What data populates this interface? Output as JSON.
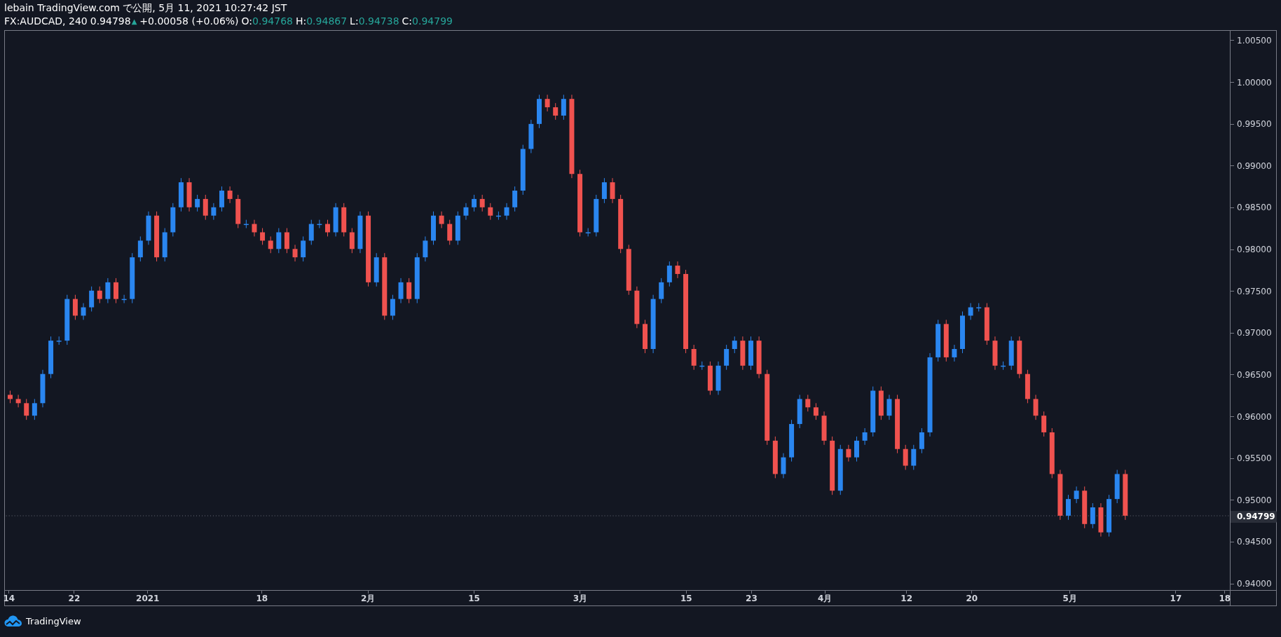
{
  "header": {
    "title": "lebain TradingView.com で公開, 5月 11, 2021 10:27:42 JST"
  },
  "legend": {
    "symbol": "FX:AUDCAD, 240",
    "last": "0.94798",
    "change_mark": "▲",
    "change": "+0.00058 (+0.06%)",
    "ohlc": [
      {
        "label": "O:",
        "value": "0.94768"
      },
      {
        "label": "H:",
        "value": "0.94867"
      },
      {
        "label": "L:",
        "value": "0.94738"
      },
      {
        "label": "C:",
        "value": "0.94799"
      }
    ]
  },
  "chart": {
    "chart_data": {
      "type": "candlestick",
      "ylim": [
        0.93908,
        1.00617
      ],
      "yticks": [
        {
          "value": 1.005,
          "label": "1.00500"
        },
        {
          "value": 1.0,
          "label": "1.00000"
        },
        {
          "value": 0.995,
          "label": "0.99500"
        },
        {
          "value": 0.99,
          "label": "0.99000"
        },
        {
          "value": 0.985,
          "label": "0.98500"
        },
        {
          "value": 0.98,
          "label": "0.98000"
        },
        {
          "value": 0.975,
          "label": "0.97500"
        },
        {
          "value": 0.97,
          "label": "0.97000"
        },
        {
          "value": 0.965,
          "label": "0.96500"
        },
        {
          "value": 0.96,
          "label": "0.96000"
        },
        {
          "value": 0.955,
          "label": "0.95500"
        },
        {
          "value": 0.95,
          "label": "0.95000"
        },
        {
          "value": 0.945,
          "label": "0.94500"
        },
        {
          "value": 0.94,
          "label": "0.94000"
        }
      ],
      "categories": [
        "14",
        null,
        null,
        null,
        null,
        null,
        null,
        null,
        "22",
        null,
        null,
        null,
        null,
        null,
        null,
        null,
        null,
        "2021",
        null,
        null,
        null,
        null,
        null,
        null,
        null,
        null,
        null,
        null,
        null,
        null,
        null,
        "18",
        null,
        null,
        null,
        null,
        null,
        null,
        null,
        null,
        null,
        null,
        null,
        null,
        "2月",
        null,
        null,
        null,
        null,
        null,
        null,
        null,
        null,
        null,
        null,
        null,
        null,
        "15",
        null,
        null,
        null,
        null,
        null,
        null,
        null,
        null,
        null,
        null,
        null,
        null,
        "3月",
        null,
        null,
        null,
        null,
        null,
        null,
        null,
        null,
        null,
        null,
        null,
        null,
        "15",
        null,
        null,
        null,
        null,
        null,
        null,
        null,
        "23",
        null,
        null,
        null,
        null,
        null,
        null,
        null,
        null,
        "4月",
        null,
        null,
        null,
        null,
        null,
        null,
        null,
        null,
        null,
        "12",
        null,
        null,
        null,
        null,
        null,
        null,
        null,
        "20",
        null,
        null,
        null,
        null,
        null,
        null,
        null,
        null,
        null,
        null,
        null,
        "5月",
        null,
        null,
        null,
        null,
        null,
        null,
        null,
        null,
        null,
        null,
        null,
        null,
        "17",
        null,
        null,
        null,
        null,
        null,
        "18"
      ],
      "ohlc": [
        [
          0.9625,
          0.963,
          0.9615,
          0.962
        ],
        [
          0.962,
          0.9625,
          0.961,
          0.9615
        ],
        [
          0.9615,
          0.962,
          0.9595,
          0.96
        ],
        [
          0.96,
          0.962,
          0.9595,
          0.9615
        ],
        [
          0.9615,
          0.9655,
          0.961,
          0.965
        ],
        [
          0.965,
          0.9695,
          0.9645,
          0.969
        ],
        [
          0.969,
          0.9695,
          0.9685,
          0.969
        ],
        [
          0.969,
          0.9745,
          0.9685,
          0.974
        ],
        [
          0.974,
          0.9745,
          0.9715,
          0.972
        ],
        [
          0.972,
          0.9735,
          0.9715,
          0.973
        ],
        [
          0.973,
          0.9755,
          0.9725,
          0.975
        ],
        [
          0.975,
          0.9755,
          0.9735,
          0.974
        ],
        [
          0.974,
          0.9765,
          0.9735,
          0.976
        ],
        [
          0.976,
          0.9765,
          0.9735,
          0.974
        ],
        [
          0.974,
          0.9745,
          0.9735,
          0.974
        ],
        [
          0.974,
          0.9795,
          0.9735,
          0.979
        ],
        [
          0.979,
          0.9815,
          0.9785,
          0.981
        ],
        [
          0.981,
          0.9845,
          0.9805,
          0.984
        ],
        [
          0.984,
          0.9845,
          0.9785,
          0.979
        ],
        [
          0.979,
          0.9825,
          0.9785,
          0.982
        ],
        [
          0.982,
          0.9855,
          0.9815,
          0.985
        ],
        [
          0.985,
          0.9885,
          0.9845,
          0.988
        ],
        [
          0.988,
          0.9885,
          0.9845,
          0.985
        ],
        [
          0.985,
          0.9865,
          0.9845,
          0.986
        ],
        [
          0.986,
          0.9865,
          0.9835,
          0.984
        ],
        [
          0.984,
          0.9855,
          0.9835,
          0.985
        ],
        [
          0.985,
          0.9875,
          0.9845,
          0.987
        ],
        [
          0.987,
          0.9875,
          0.9855,
          0.986
        ],
        [
          0.986,
          0.9865,
          0.9825,
          0.983
        ],
        [
          0.983,
          0.9835,
          0.9825,
          0.983
        ],
        [
          0.983,
          0.9835,
          0.9815,
          0.982
        ],
        [
          0.982,
          0.9825,
          0.9805,
          0.981
        ],
        [
          0.981,
          0.9815,
          0.9795,
          0.98
        ],
        [
          0.98,
          0.9825,
          0.9795,
          0.982
        ],
        [
          0.982,
          0.9825,
          0.9795,
          0.98
        ],
        [
          0.98,
          0.9805,
          0.9785,
          0.979
        ],
        [
          0.979,
          0.9815,
          0.9785,
          0.981
        ],
        [
          0.981,
          0.9835,
          0.9805,
          0.983
        ],
        [
          0.983,
          0.9835,
          0.9825,
          0.983
        ],
        [
          0.983,
          0.9835,
          0.9815,
          0.982
        ],
        [
          0.982,
          0.9855,
          0.9815,
          0.985
        ],
        [
          0.985,
          0.9855,
          0.9815,
          0.982
        ],
        [
          0.982,
          0.9825,
          0.9795,
          0.98
        ],
        [
          0.98,
          0.9845,
          0.9795,
          0.984
        ],
        [
          0.984,
          0.9845,
          0.9755,
          0.976
        ],
        [
          0.976,
          0.9795,
          0.9755,
          0.979
        ],
        [
          0.979,
          0.9795,
          0.9715,
          0.972
        ],
        [
          0.972,
          0.9745,
          0.9715,
          0.974
        ],
        [
          0.974,
          0.9765,
          0.9735,
          0.976
        ],
        [
          0.976,
          0.9765,
          0.9735,
          0.974
        ],
        [
          0.974,
          0.9795,
          0.9735,
          0.979
        ],
        [
          0.979,
          0.9815,
          0.9785,
          0.981
        ],
        [
          0.981,
          0.9845,
          0.9805,
          0.984
        ],
        [
          0.984,
          0.9845,
          0.9825,
          0.983
        ],
        [
          0.983,
          0.9835,
          0.9805,
          0.981
        ],
        [
          0.981,
          0.9845,
          0.9805,
          0.984
        ],
        [
          0.984,
          0.9855,
          0.9835,
          0.985
        ],
        [
          0.985,
          0.9865,
          0.9845,
          0.986
        ],
        [
          0.986,
          0.9865,
          0.9845,
          0.985
        ],
        [
          0.985,
          0.9855,
          0.9835,
          0.984
        ],
        [
          0.984,
          0.9845,
          0.9835,
          0.984
        ],
        [
          0.984,
          0.9855,
          0.9835,
          0.985
        ],
        [
          0.985,
          0.9875,
          0.9845,
          0.987
        ],
        [
          0.987,
          0.9925,
          0.9865,
          0.992
        ],
        [
          0.992,
          0.9955,
          0.9915,
          0.995
        ],
        [
          0.995,
          0.9985,
          0.9945,
          0.998
        ],
        [
          0.998,
          0.9985,
          0.9965,
          0.997
        ],
        [
          0.997,
          0.9975,
          0.9955,
          0.996
        ],
        [
          0.996,
          0.9985,
          0.9955,
          0.998
        ],
        [
          0.998,
          0.9985,
          0.9885,
          0.989
        ],
        [
          0.989,
          0.9895,
          0.9815,
          0.982
        ],
        [
          0.982,
          0.9825,
          0.9815,
          0.982
        ],
        [
          0.982,
          0.9865,
          0.9815,
          0.986
        ],
        [
          0.986,
          0.9885,
          0.9855,
          0.988
        ],
        [
          0.988,
          0.9885,
          0.9855,
          0.986
        ],
        [
          0.986,
          0.9865,
          0.9795,
          0.98
        ],
        [
          0.98,
          0.9805,
          0.9745,
          0.975
        ],
        [
          0.975,
          0.9755,
          0.9705,
          0.971
        ],
        [
          0.971,
          0.9715,
          0.9675,
          0.968
        ],
        [
          0.968,
          0.9745,
          0.9675,
          0.974
        ],
        [
          0.974,
          0.9765,
          0.9735,
          0.976
        ],
        [
          0.976,
          0.9785,
          0.9755,
          0.978
        ],
        [
          0.978,
          0.9785,
          0.9765,
          0.977
        ],
        [
          0.977,
          0.9775,
          0.9675,
          0.968
        ],
        [
          0.968,
          0.9685,
          0.9655,
          0.966
        ],
        [
          0.966,
          0.9665,
          0.9655,
          0.966
        ],
        [
          0.966,
          0.9665,
          0.9625,
          0.963
        ],
        [
          0.963,
          0.9665,
          0.9625,
          0.966
        ],
        [
          0.966,
          0.9685,
          0.9655,
          0.968
        ],
        [
          0.968,
          0.9695,
          0.9675,
          0.969
        ],
        [
          0.969,
          0.9695,
          0.9655,
          0.966
        ],
        [
          0.966,
          0.9695,
          0.9655,
          0.969
        ],
        [
          0.969,
          0.9695,
          0.9645,
          0.965
        ],
        [
          0.965,
          0.9655,
          0.9565,
          0.957
        ],
        [
          0.957,
          0.9575,
          0.9525,
          0.953
        ],
        [
          0.953,
          0.9555,
          0.9525,
          0.955
        ],
        [
          0.955,
          0.9595,
          0.9545,
          0.959
        ],
        [
          0.959,
          0.9625,
          0.9585,
          0.962
        ],
        [
          0.962,
          0.9625,
          0.9605,
          0.961
        ],
        [
          0.961,
          0.9615,
          0.9595,
          0.96
        ],
        [
          0.96,
          0.9605,
          0.9565,
          0.957
        ],
        [
          0.957,
          0.9575,
          0.9505,
          0.951
        ],
        [
          0.951,
          0.9565,
          0.9505,
          0.956
        ],
        [
          0.956,
          0.9565,
          0.9545,
          0.955
        ],
        [
          0.955,
          0.9575,
          0.9545,
          0.957
        ],
        [
          0.957,
          0.9585,
          0.9565,
          0.958
        ],
        [
          0.958,
          0.9635,
          0.9575,
          0.963
        ],
        [
          0.963,
          0.9635,
          0.9595,
          0.96
        ],
        [
          0.96,
          0.9625,
          0.9595,
          0.962
        ],
        [
          0.962,
          0.9625,
          0.9555,
          0.956
        ],
        [
          0.956,
          0.9565,
          0.9535,
          0.954
        ],
        [
          0.954,
          0.9565,
          0.9535,
          0.956
        ],
        [
          0.956,
          0.9585,
          0.9555,
          0.958
        ],
        [
          0.958,
          0.9675,
          0.9575,
          0.967
        ],
        [
          0.967,
          0.9715,
          0.9665,
          0.971
        ],
        [
          0.971,
          0.9715,
          0.9665,
          0.967
        ],
        [
          0.967,
          0.9685,
          0.9665,
          0.968
        ],
        [
          0.968,
          0.9725,
          0.9675,
          0.972
        ],
        [
          0.972,
          0.9735,
          0.9715,
          0.973
        ],
        [
          0.973,
          0.9735,
          0.9725,
          0.973
        ],
        [
          0.973,
          0.9735,
          0.9685,
          0.969
        ],
        [
          0.969,
          0.9695,
          0.9655,
          0.966
        ],
        [
          0.966,
          0.9665,
          0.9655,
          0.966
        ],
        [
          0.966,
          0.9695,
          0.9655,
          0.969
        ],
        [
          0.969,
          0.9695,
          0.9645,
          0.965
        ],
        [
          0.965,
          0.9655,
          0.9615,
          0.962
        ],
        [
          0.962,
          0.9625,
          0.9595,
          0.96
        ],
        [
          0.96,
          0.9605,
          0.9575,
          0.958
        ],
        [
          0.958,
          0.9585,
          0.9525,
          0.953
        ],
        [
          0.953,
          0.9535,
          0.9475,
          0.948
        ],
        [
          0.948,
          0.9505,
          0.9475,
          0.95
        ],
        [
          0.95,
          0.9515,
          0.9495,
          0.951
        ],
        [
          0.951,
          0.9515,
          0.9465,
          0.947
        ],
        [
          0.947,
          0.9495,
          0.9465,
          0.949
        ],
        [
          0.949,
          0.9495,
          0.9455,
          0.946
        ],
        [
          0.946,
          0.9505,
          0.9455,
          0.95
        ],
        [
          0.95,
          0.9535,
          0.9495,
          0.953
        ],
        [
          0.953,
          0.9535,
          0.9475,
          0.948
        ],
        null,
        null,
        null,
        null,
        null,
        null,
        null,
        null,
        null,
        null,
        null,
        null
      ],
      "ref_lines": [
        {
          "axis": "y",
          "value": 0.94799,
          "label": "0.94799"
        }
      ]
    }
  },
  "footer": {
    "brand": "TradingView"
  }
}
